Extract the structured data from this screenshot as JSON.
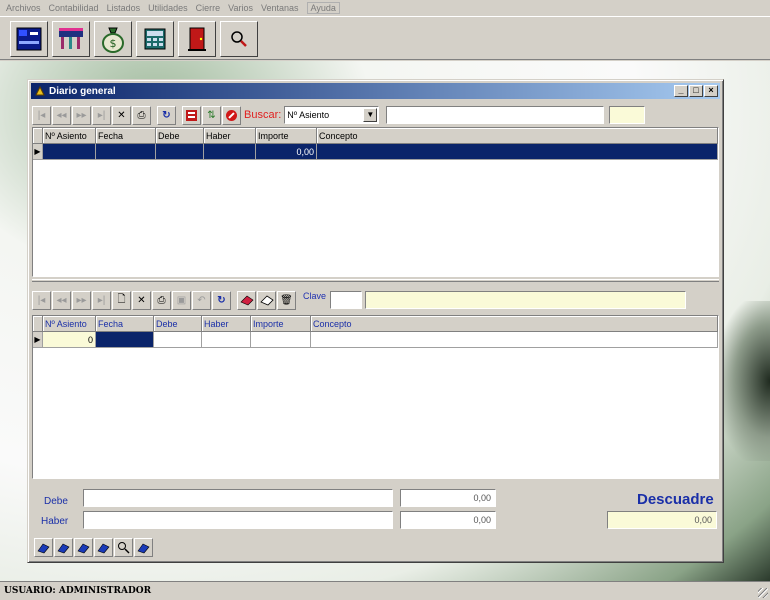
{
  "menu": {
    "items": [
      "Archivos",
      "Contabilidad",
      "Listados",
      "Utilidades",
      "Cierre",
      "Varios",
      "Ventanas",
      "Ayuda"
    ]
  },
  "window": {
    "title": "Diario general"
  },
  "search": {
    "label": "Buscar:",
    "field": "Nº Asiento"
  },
  "grid1": {
    "columns": [
      "Nº Asiento",
      "Fecha",
      "Debe",
      "Haber",
      "Importe",
      "Concepto"
    ],
    "row": {
      "importe": "0,00"
    }
  },
  "key": {
    "label": "Clave"
  },
  "grid2": {
    "columns": [
      "Nº Asiento",
      "Fecha",
      "Debe",
      "Haber",
      "Importe",
      "Concepto"
    ],
    "row": {
      "asiento": "0"
    }
  },
  "totals": {
    "debe_label": "Debe",
    "haber_label": "Haber",
    "debe_value": "0,00",
    "haber_value": "0,00",
    "descuadre_label": "Descuadre",
    "descuadre_value": "0,00"
  },
  "status": {
    "user": "USUARIO: ADMINISTRADOR"
  },
  "colors": {
    "titlebar": "#0a246a",
    "selection": "#0a246a",
    "label_blue": "#1a2fa8",
    "buscar_red": "#e02020",
    "field_yellow": "#fafad8"
  }
}
